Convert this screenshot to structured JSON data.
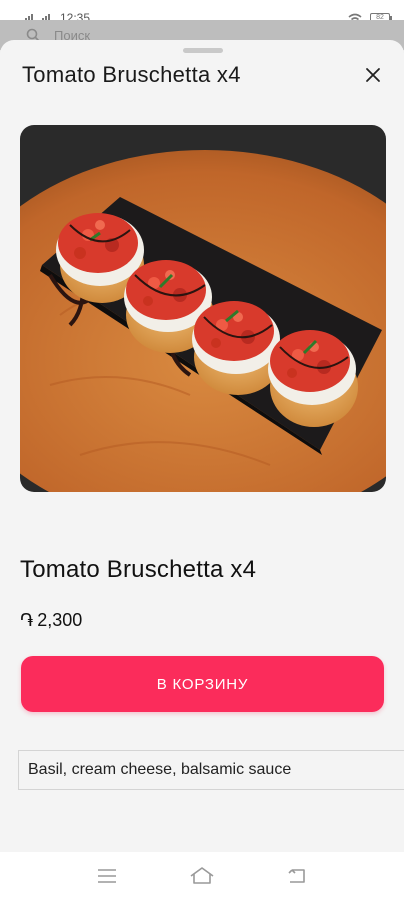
{
  "status_bar": {
    "time": "12:35",
    "battery": "82"
  },
  "background_page": {
    "search_text": "Поиск"
  },
  "sheet": {
    "title": "Tomato Bruschetta x4"
  },
  "product": {
    "name": "Tomato Bruschetta x4",
    "currency_symbol": "֏",
    "price": "2,300",
    "add_to_cart_label": "В КОРЗИНУ",
    "description": "Basil, cream cheese, balsamic sauce"
  },
  "colors": {
    "accent": "#fb2c5b",
    "sheet_bg": "#f4f4f4"
  },
  "icons": {
    "close": "close-icon",
    "menu": "menu-icon",
    "home": "home-icon",
    "back": "back-icon"
  }
}
